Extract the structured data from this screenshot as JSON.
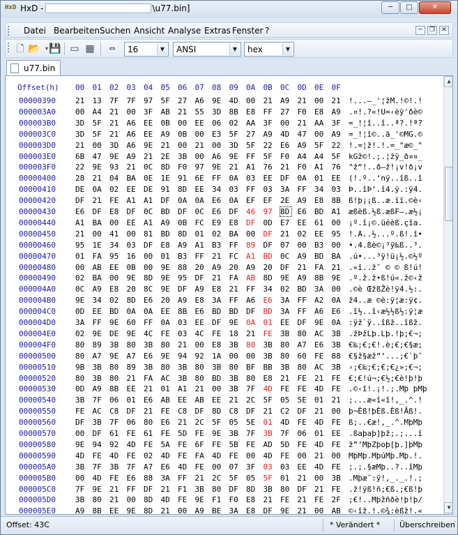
{
  "window": {
    "title_prefix": "HxD -",
    "title_suffix": "\\u77.bin]",
    "min_label": "─",
    "max_label": "□",
    "close_label": "✕"
  },
  "menu": {
    "items": [
      "Datei",
      "Bearbeiten",
      "Suchen",
      "Ansicht",
      "Analyse",
      "Extras",
      "Fenster",
      "?"
    ]
  },
  "toolbar": {
    "bytes_per_row": "16",
    "charset": "ANSI",
    "display": "hex"
  },
  "tab": {
    "label": "u77.bin"
  },
  "hex": {
    "offset_header": "Offset(h)",
    "columns": [
      "00",
      "01",
      "02",
      "03",
      "04",
      "05",
      "06",
      "07",
      "08",
      "09",
      "0A",
      "0B",
      "0C",
      "0D",
      "0E",
      "0F"
    ],
    "rows": [
      {
        "offset": "00000390",
        "bytes": [
          "21",
          "13",
          "7F",
          "7F",
          "97",
          "5F",
          "27",
          "A6",
          "9E",
          "4D",
          "00",
          "21",
          "A9",
          "21",
          "00",
          "21"
        ],
        "ascii": "!...—_'¦žM.!©!.!",
        "red": []
      },
      {
        "offset": "000003A0",
        "bytes": [
          "00",
          "A4",
          "21",
          "00",
          "3F",
          "AB",
          "21",
          "55",
          "3D",
          "8B",
          "E8",
          "FF",
          "27",
          "F0",
          "E8",
          "A9"
        ],
        "ascii": ".¤!.?«!U=‹èÿ'ðè©",
        "red": []
      },
      {
        "offset": "000003B0",
        "bytes": [
          "3D",
          "5F",
          "21",
          "A6",
          "EE",
          "0B",
          "00",
          "EE",
          "06",
          "02",
          "AA",
          "3F",
          "00",
          "21",
          "AA",
          "3F"
        ],
        "ascii": "=_!¦î..î..ª?.!ª?",
        "red": []
      },
      {
        "offset": "000003C0",
        "bytes": [
          "3D",
          "5F",
          "21",
          "A6",
          "EE",
          "A9",
          "0B",
          "00",
          "E3",
          "5F",
          "27",
          "A9",
          "4D",
          "47",
          "00",
          "A9"
        ],
        "ascii": "=_!¦î©..ã_'©MG.©",
        "red": []
      },
      {
        "offset": "000003D0",
        "bytes": [
          "21",
          "00",
          "3D",
          "A6",
          "9E",
          "21",
          "00",
          "21",
          "00",
          "3D",
          "5F",
          "22",
          "E6",
          "A9",
          "5F",
          "22"
        ],
        "ascii": "!.=¦ž!.!.=_\"æ©_\"",
        "red": []
      },
      {
        "offset": "000003E0",
        "bytes": [
          "6B",
          "47",
          "9E",
          "A9",
          "21",
          "2E",
          "3B",
          "00",
          "A6",
          "9E",
          "FF",
          "5F",
          "F0",
          "A4",
          "A4",
          "5F"
        ],
        "ascii": "kGž©!.;.¦žÿ_ð¤¤_",
        "red": []
      },
      {
        "offset": "000003F0",
        "bytes": [
          "22",
          "9E",
          "93",
          "21",
          "0C",
          "8D",
          "F0",
          "97",
          "9E",
          "21",
          "A1",
          "76",
          "21",
          "F0",
          "A1",
          "76"
        ],
        "ascii": "\"ž“!..ð—ž!¡v!ð¡v",
        "red": []
      },
      {
        "offset": "00000400",
        "bytes": [
          "28",
          "21",
          "04",
          "BA",
          "0E",
          "1E",
          "91",
          "6E",
          "FF",
          "0A",
          "03",
          "EE",
          "DF",
          "0A",
          "01",
          "EE"
        ],
        "ascii": "(!.º..‘nÿ..îß..î",
        "red": []
      },
      {
        "offset": "00000410",
        "bytes": [
          "DE",
          "0A",
          "02",
          "EE",
          "DE",
          "91",
          "8D",
          "EE",
          "34",
          "03",
          "FF",
          "03",
          "3A",
          "FF",
          "34",
          "03"
        ],
        "ascii": "Þ..îÞ‘.î4.ÿ.:ÿ4.",
        "red": []
      },
      {
        "offset": "00000420",
        "bytes": [
          "DF",
          "21",
          "FE",
          "A1",
          "A1",
          "DF",
          "0A",
          "0A",
          "E6",
          "0A",
          "EF",
          "EF",
          "2E",
          "A9",
          "E8",
          "8B"
        ],
        "ascii": "ß!þ¡¡ß..æ.ïï.©è‹",
        "red": []
      },
      {
        "offset": "00000430",
        "bytes": [
          "E6",
          "DF",
          "E8",
          "DF",
          "0C",
          "BD",
          "DF",
          "0C",
          "E6",
          "DF",
          "46",
          "97",
          "8D",
          "E6",
          "BD",
          "A1"
        ],
        "ascii": "æßèß.½ß.æßF—.æ½¡",
        "red": [
          10,
          11
        ],
        "sel": 12
      },
      {
        "offset": "00000440",
        "bytes": [
          "A1",
          "BA",
          "00",
          "EE",
          "A1",
          "A9",
          "0B",
          "FC",
          "E9",
          "E8",
          "DF",
          "0D",
          "E7",
          "EE",
          "61",
          "00"
        ],
        "ascii": "¡º.î¡©.üéèß.çîa.",
        "red": [
          10
        ]
      },
      {
        "offset": "00000450",
        "bytes": [
          "21",
          "00",
          "41",
          "00",
          "81",
          "BD",
          "8D",
          "01",
          "02",
          "BA",
          "00",
          "DF",
          "21",
          "02",
          "EE",
          "95"
        ],
        "ascii": "!.A..½...º.ß!.î•",
        "red": [
          11
        ]
      },
      {
        "offset": "00000460",
        "bytes": [
          "95",
          "1E",
          "34",
          "03",
          "DF",
          "E8",
          "A9",
          "A1",
          "B3",
          "FF",
          "89",
          "DF",
          "07",
          "00",
          "B3",
          "00"
        ],
        "ascii": "•.4.ßè©¡³ÿ‰ß..³.",
        "red": [
          10
        ]
      },
      {
        "offset": "00000470",
        "bytes": [
          "01",
          "FA",
          "95",
          "16",
          "00",
          "01",
          "B3",
          "FF",
          "21",
          "FC",
          "A1",
          "BD",
          "0C",
          "A9",
          "BD",
          "BA"
        ],
        "ascii": ".ú•...³ÿ!ü¡½.©½º",
        "red": [
          10,
          11
        ]
      },
      {
        "offset": "00000480",
        "bytes": [
          "00",
          "AB",
          "EE",
          "0B",
          "00",
          "9E",
          "88",
          "20",
          "A9",
          "20",
          "A9",
          "20",
          "DF",
          "21",
          "FA",
          "21"
        ],
        "ascii": ".«î..žˆ © © ß!ú!",
        "red": []
      },
      {
        "offset": "00000490",
        "bytes": [
          "02",
          "BA",
          "00",
          "9E",
          "8D",
          "9E",
          "95",
          "DF",
          "21",
          "FA",
          "AB",
          "8D",
          "9E",
          "A9",
          "8B",
          "9E"
        ],
        "ascii": ".º.ž.ž•ß!ú«.ž©‹ž",
        "red": [
          10
        ]
      },
      {
        "offset": "000004A0",
        "bytes": [
          "0C",
          "A9",
          "E8",
          "20",
          "8C",
          "9E",
          "DF",
          "A9",
          "E8",
          "21",
          "FF",
          "34",
          "02",
          "BD",
          "3A",
          "00"
        ],
        "ascii": ".©è ŒžßŽè!ÿ4.½:.",
        "red": []
      },
      {
        "offset": "000004B0",
        "bytes": [
          "9E",
          "34",
          "02",
          "8D",
          "E6",
          "20",
          "A9",
          "E8",
          "3A",
          "FF",
          "A6",
          "E6",
          "3A",
          "FF",
          "A2",
          "0A"
        ],
        "ascii": "ž4..æ ©è:ÿ¦æ:ÿ¢.",
        "red": [
          11
        ]
      },
      {
        "offset": "000004C0",
        "bytes": [
          "0D",
          "EE",
          "BD",
          "0A",
          "0A",
          "EE",
          "8B",
          "E6",
          "BD",
          "BD",
          "DF",
          "BD",
          "3A",
          "FF",
          "A6",
          "E6"
        ],
        "ascii": ".î½..î‹æ½½ß½:ÿ¦æ",
        "red": [
          11
        ]
      },
      {
        "offset": "000004D0",
        "bytes": [
          "3A",
          "FF",
          "9E",
          "60",
          "FF",
          "0A",
          "03",
          "EE",
          "DF",
          "9E",
          "0A",
          "01",
          "EE",
          "DF",
          "9E",
          "0A"
        ],
        "ascii": ":ÿž`ÿ..îßž..îßž.",
        "red": [
          10,
          11
        ]
      },
      {
        "offset": "000004E0",
        "bytes": [
          "02",
          "9E",
          "DE",
          "9E",
          "4C",
          "FE",
          "03",
          "4C",
          "FE",
          "18",
          "21",
          "FE",
          "3B",
          "80",
          "AC",
          "3B"
        ],
        "ascii": ".žÞžLþ.Lþ.!þ;€¬;",
        "red": [
          11
        ]
      },
      {
        "offset": "000004F0",
        "bytes": [
          "80",
          "89",
          "3B",
          "80",
          "3B",
          "80",
          "21",
          "00",
          "E8",
          "3B",
          "80",
          "3B",
          "80",
          "A7",
          "E6",
          "3B"
        ],
        "ascii": "€‰;€;€!.è;€;€§æ;",
        "red": [
          10
        ]
      },
      {
        "offset": "00000500",
        "bytes": [
          "80",
          "A7",
          "9E",
          "A7",
          "E6",
          "9E",
          "94",
          "92",
          "1A",
          "00",
          "00",
          "3B",
          "80",
          "60",
          "FE",
          "88"
        ],
        "ascii": "€§ž§æž”’...;€`þˆ",
        "red": []
      },
      {
        "offset": "00000510",
        "bytes": [
          "9B",
          "3B",
          "80",
          "89",
          "3B",
          "80",
          "3B",
          "80",
          "3B",
          "80",
          "BF",
          "BB",
          "3B",
          "80",
          "AC",
          "3B"
        ],
        "ascii": "›;€‰;€;€;€¿»;€¬;",
        "red": []
      },
      {
        "offset": "00000520",
        "bytes": [
          "80",
          "3B",
          "80",
          "21",
          "FA",
          "AC",
          "3B",
          "80",
          "BD",
          "3B",
          "80",
          "E8",
          "21",
          "FE",
          "21",
          "FE"
        ],
        "ascii": "€;€!ú¬;€½;€è!þ!þ",
        "red": []
      },
      {
        "offset": "00000530",
        "bytes": [
          "0D",
          "A9",
          "8B",
          "EE",
          "21",
          "01",
          "A1",
          "21",
          "00",
          "3B",
          "7F",
          "4D",
          "FE",
          "FE",
          "4D",
          "FE"
        ],
        "ascii": ".©‹î!.¡!.;.Mþ þMþ",
        "red": [
          11
        ]
      },
      {
        "offset": "00000540",
        "bytes": [
          "3B",
          "7F",
          "06",
          "01",
          "E6",
          "AB",
          "EE",
          "AB",
          "EE",
          "21",
          "2C",
          "5F",
          "05",
          "5E",
          "01",
          "21"
        ],
        "ascii": ";...æ«î«î!,_.^.!",
        "red": []
      },
      {
        "offset": "00000550",
        "bytes": [
          "FE",
          "AC",
          "C8",
          "DF",
          "21",
          "FE",
          "C8",
          "DF",
          "8D",
          "C8",
          "DF",
          "21",
          "C2",
          "DF",
          "21",
          "00"
        ],
        "ascii": "þ¬Èß!þÈß.Èß!Âß!.",
        "red": []
      },
      {
        "offset": "00000560",
        "bytes": [
          "DF",
          "3B",
          "7F",
          "06",
          "80",
          "E6",
          "21",
          "2C",
          "5F",
          "05",
          "5E",
          "01",
          "4D",
          "FE",
          "4D",
          "FE"
        ],
        "ascii": "ß;..€æ!,_.^.MþMþ",
        "red": [
          11
        ]
      },
      {
        "offset": "00000570",
        "bytes": [
          "00",
          "DF",
          "61",
          "FE",
          "61",
          "FE",
          "5D",
          "FE",
          "9E",
          "3B",
          "7F",
          "3B",
          "7F",
          "06",
          "01",
          "EE"
        ],
        "ascii": ".ßaþaþ]þž;.;...î",
        "red": [
          11
        ]
      },
      {
        "offset": "00000580",
        "bytes": [
          "9E",
          "94",
          "92",
          "4D",
          "FE",
          "5A",
          "FE",
          "6F",
          "FE",
          "5B",
          "FE",
          "AD",
          "5D",
          "FE",
          "4D",
          "FE"
        ],
        "ascii": "ž”’MþZþoþ[þ.]þMþ",
        "red": []
      },
      {
        "offset": "00000590",
        "bytes": [
          "4D",
          "FE",
          "4D",
          "FE",
          "02",
          "4D",
          "FE",
          "FA",
          "4D",
          "FE",
          "00",
          "4D",
          "FE",
          "00",
          "21",
          "00"
        ],
        "ascii": "MþMþ.MþúMþ.Mþ.!.",
        "red": []
      },
      {
        "offset": "000005A0",
        "bytes": [
          "3B",
          "7F",
          "3B",
          "7F",
          "A7",
          "E6",
          "4D",
          "FE",
          "00",
          "07",
          "3F",
          "03",
          "03",
          "EE",
          "4D",
          "FE"
        ],
        "ascii": ";.;.§æMþ..?..îMþ",
        "red": [
          11
        ]
      },
      {
        "offset": "000005B0",
        "bytes": [
          "00",
          "4D",
          "FE",
          "E6",
          "88",
          "3A",
          "FF",
          "21",
          "2C",
          "5F",
          "05",
          "5F",
          "01",
          "21",
          "00",
          "3B"
        ],
        "ascii": ".Mþæˆ:ÿ!,_._.!.;",
        "red": [
          11
        ]
      },
      {
        "offset": "000005C0",
        "bytes": [
          "7F",
          "9E",
          "21",
          "FF",
          "DF",
          "21",
          "F1",
          "3B",
          "80",
          "DF",
          "8D",
          "3B",
          "80",
          "DF",
          "21",
          "FE"
        ],
        "ascii": ".ž!ÿß!ñ;€ß.;€ß!þ",
        "red": []
      },
      {
        "offset": "000005D0",
        "bytes": [
          "3B",
          "80",
          "21",
          "00",
          "8D",
          "4D",
          "FE",
          "9E",
          "F1",
          "F0",
          "E8",
          "21",
          "FE",
          "21",
          "FE",
          "2F"
        ],
        "ascii": ";€!..Mþžñðè!þ!þ/",
        "red": []
      },
      {
        "offset": "000005E0",
        "bytes": [
          "A9",
          "8B",
          "EE",
          "9E",
          "8D",
          "21",
          "00",
          "A9",
          "BE",
          "3A",
          "E8",
          "DF",
          "9E",
          "21",
          "00",
          "AB"
        ],
        "ascii": "©‹îž.!.©¾:èßž!.«",
        "red": []
      }
    ]
  },
  "status": {
    "offset": "Offset: 43C",
    "modified": "* Verändert *",
    "mode": "Überschreiben"
  }
}
